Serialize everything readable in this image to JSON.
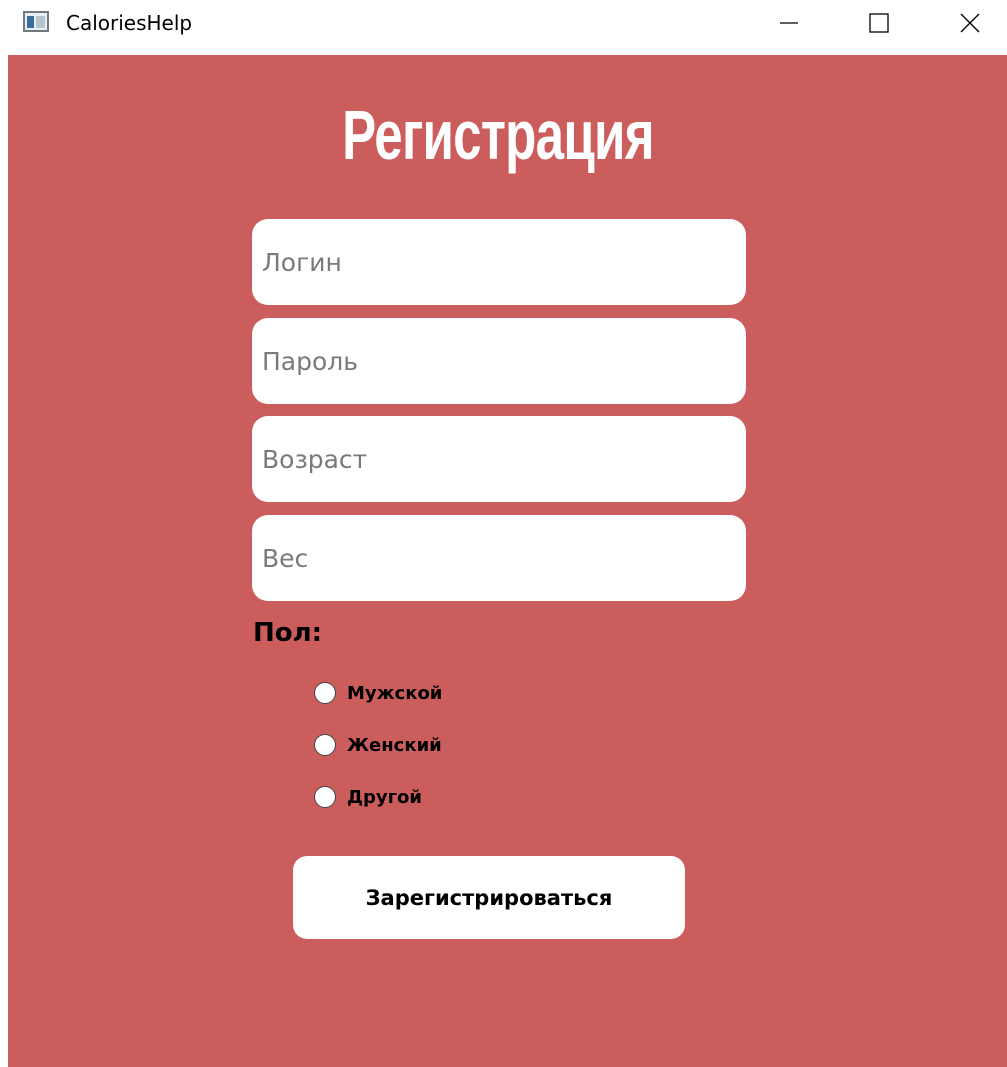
{
  "window": {
    "title": "CaloriesHelp"
  },
  "form": {
    "heading": "Регистрация",
    "fields": {
      "login_placeholder": "Логин",
      "password_placeholder": "Пароль",
      "age_placeholder": "Возраст",
      "weight_placeholder": "Вес"
    },
    "gender": {
      "label": "Пол:",
      "options": [
        {
          "label": "Мужской",
          "selected": false
        },
        {
          "label": "Женский",
          "selected": false
        },
        {
          "label": "Другой",
          "selected": false
        }
      ]
    },
    "submit_label": "Зарегистрироваться"
  },
  "colors": {
    "background": "#cc5d5d",
    "field_background": "#ffffff",
    "heading_text": "#ffffff"
  },
  "icons": {
    "app": "app-window-icon",
    "minimize": "minimize-icon",
    "maximize": "maximize-icon",
    "close": "close-icon"
  }
}
